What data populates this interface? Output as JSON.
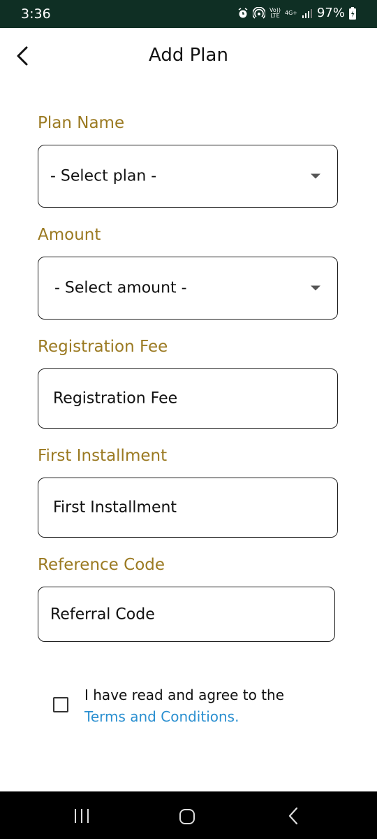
{
  "status_bar": {
    "time": "3:36",
    "volte_top": "Vo))",
    "volte_bottom": "LTE",
    "network": "4G+",
    "battery": "97%"
  },
  "header": {
    "title": "Add Plan"
  },
  "form": {
    "plan_name": {
      "label": "Plan Name",
      "value": "- Select plan -"
    },
    "amount": {
      "label": "Amount",
      "value": "- Select amount -"
    },
    "registration_fee": {
      "label": "Registration Fee",
      "placeholder": "Registration Fee"
    },
    "first_installment": {
      "label": "First Installment",
      "placeholder": "First Installment"
    },
    "reference_code": {
      "label": "Reference Code",
      "placeholder": "Referral Code"
    }
  },
  "terms": {
    "text": "I have read and agree to the",
    "link": "Terms and Conditions."
  },
  "colors": {
    "label": "#9b7a22",
    "link": "#2a8fd0",
    "status_bar": "#0f2f24"
  }
}
